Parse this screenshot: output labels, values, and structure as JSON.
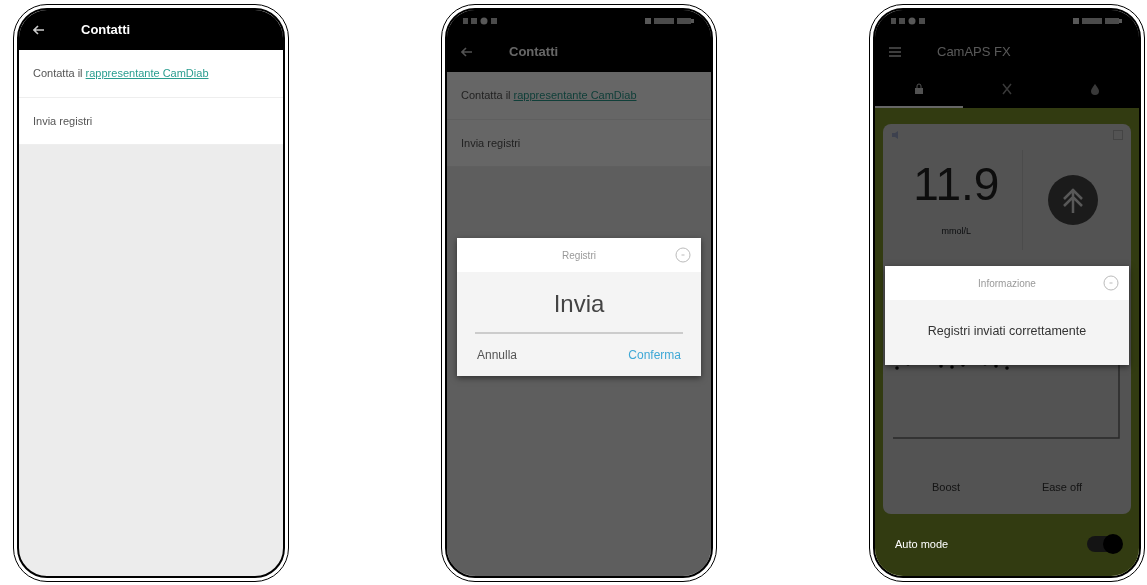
{
  "phones": [
    {
      "kind": "contacts",
      "status_bar": false,
      "dimmed": false,
      "title": "Contatti",
      "items": [
        {
          "prefix": "Contatta il",
          "link": "rappresentante CamDiab"
        },
        {
          "prefix": "Invia registri"
        }
      ]
    },
    {
      "kind": "contacts",
      "status_bar": true,
      "dimmed": true,
      "title": "Contatti",
      "items": [
        {
          "prefix": "Contatta il",
          "link": "rappresentante CamDiab"
        },
        {
          "prefix": "Invia registri"
        }
      ],
      "dialog": {
        "title": "Registri",
        "message": "Invia",
        "buttons": [
          {
            "label": "Annulla",
            "primary": false
          },
          {
            "label": "Conferma",
            "primary": true
          }
        ]
      }
    },
    {
      "kind": "home",
      "status_bar": true,
      "dimmed": true,
      "title": "CamAPS FX",
      "tabs": [
        {
          "selected": true
        },
        {
          "selected": false
        },
        {
          "selected": false
        }
      ],
      "glucose": "11.9",
      "unit": "mmol/L",
      "actions": [
        "Boost",
        "Ease off"
      ],
      "auto_mode": {
        "label": "Auto mode",
        "on": true
      },
      "dialog": {
        "title": "Informazione",
        "message": "Registri inviati correttamente"
      }
    }
  ]
}
